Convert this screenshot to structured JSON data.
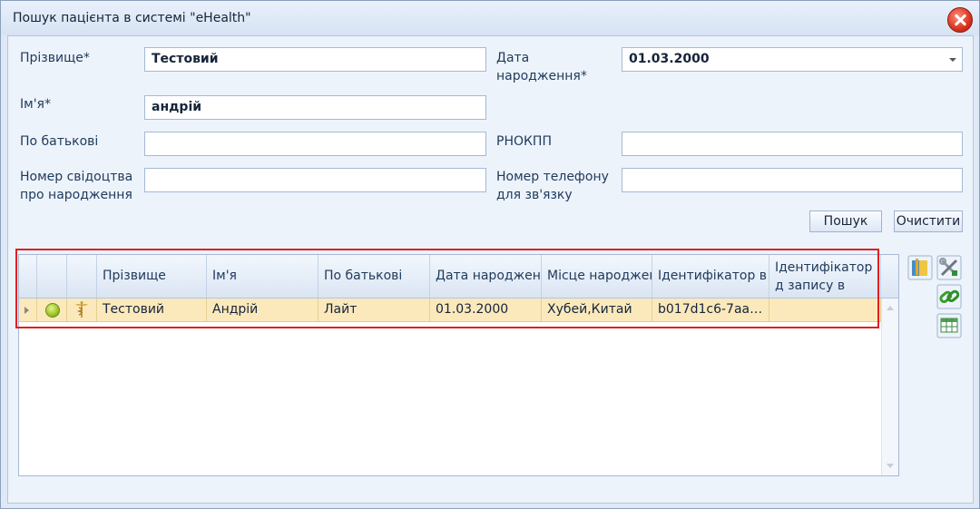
{
  "window": {
    "title": "Пошук пацієнта в системі \"eHealth\""
  },
  "form": {
    "surname_label": "Прізвище*",
    "surname_value": "Тестовий",
    "birthdate_label_1": "Дата",
    "birthdate_label_2": "народження*",
    "birthdate_value": "01.03.2000",
    "name_label": "Ім'я*",
    "name_value": "андрій",
    "patronymic_label": "По батькові",
    "patronymic_value": "",
    "rnokpp_label": "РНОКПП",
    "rnokpp_value": "",
    "birth_cert_label_1": "Номер свідоцтва",
    "birth_cert_label_2": "про народження",
    "birth_cert_value": "",
    "phone_label_1": "Номер телефону",
    "phone_label_2": "для зв'язку",
    "phone_value": ""
  },
  "buttons": {
    "search": "Пошук",
    "clear": "Очистити"
  },
  "grid": {
    "columns": [
      "Прізвище",
      "Ім'я",
      "По батькові",
      "Дата народження",
      "Місце народження",
      "Ідентифікатор в системі",
      "Ідентифікатор д запису в систем"
    ],
    "rows": [
      {
        "surname": "Тестовий",
        "name": "Андрій",
        "patronymic": "Лайт",
        "birthdate": "01.03.2000",
        "birthplace": "Хубей,Китай",
        "id": "b017d1c6-7aab...",
        "record_id": ""
      }
    ]
  },
  "icons": {
    "status": "status-dot-icon",
    "row_type": "caduceus-icon",
    "side": [
      "open-folder-icon",
      "tools-icon",
      "link-icon",
      "grid-edit-icon"
    ]
  },
  "colors": {
    "selected_row": "#fbe9bb",
    "highlight": "#e02020"
  }
}
